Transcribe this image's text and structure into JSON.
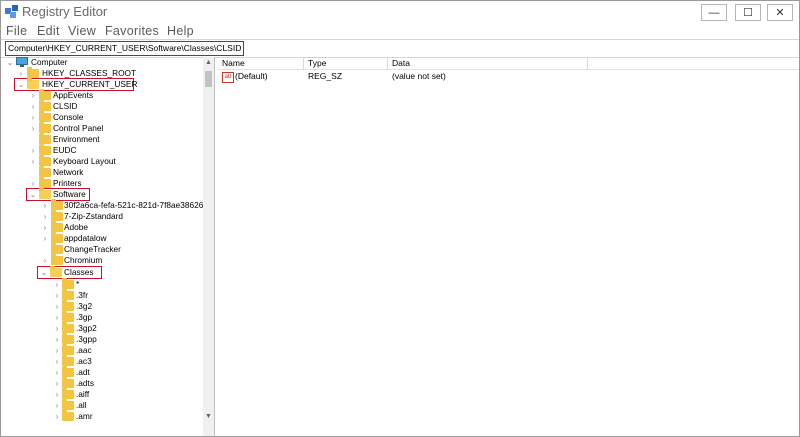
{
  "window": {
    "title": "Registry Editor"
  },
  "menu": [
    "File",
    "Edit",
    "View",
    "Favorites",
    "Help"
  ],
  "address": "Computer\\HKEY_CURRENT_USER\\Software\\Classes\\CLSID",
  "tree": [
    "Computer",
    "HKEY_CLASSES_ROOT",
    "HKEY_CURRENT_USER",
    "AppEvents",
    "CLSID",
    "Console",
    "Control Panel",
    "Environment",
    "EUDC",
    "Keyboard Layout",
    "Network",
    "Printers",
    "Software",
    "30f2a6ca-fefa-521c-821d-7f8ae38626",
    "7-Zip-Zstandard",
    "Adobe",
    "appdatalow",
    "ChangeTracker",
    "Chromium",
    "Classes",
    "*",
    ".3fr",
    ".3g2",
    ".3gp",
    ".3gp2",
    ".3gpp",
    ".aac",
    ".ac3",
    ".adt",
    ".adts",
    ".aiff",
    ".all",
    ".amr"
  ],
  "columns": {
    "name": "Name",
    "type": "Type",
    "data": "Data"
  },
  "rows": [
    {
      "name": "(Default)",
      "type": "REG_SZ",
      "data": "(value not set)",
      "icon": "string-value-icon"
    }
  ],
  "icons": {
    "close": "✕",
    "maximize": "☐",
    "minimize": "—",
    "chevron_right": "›",
    "chevron_down": "⌄",
    "scroll_up": "▲",
    "scroll_down": "▼",
    "string_value": "ab"
  },
  "colors": {
    "highlight": "#c8102e",
    "folder": "#f4c542"
  }
}
